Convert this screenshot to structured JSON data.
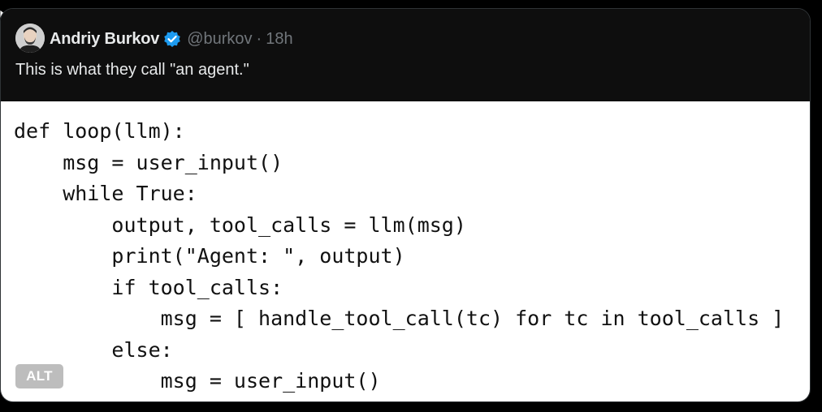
{
  "tweet": {
    "display_name": "Andriy Burkov",
    "handle": "@burkov",
    "separator": "·",
    "time": "18h",
    "text": "This is what they call \"an agent.\"",
    "verified_color": "#1d9bf0",
    "avatar_icon": "avatar-photo"
  },
  "image": {
    "alt_label": "ALT",
    "code_lines": [
      "def loop(llm):",
      "    msg = user_input()",
      "    while True:",
      "        output, tool_calls = llm(msg)",
      "        print(\"Agent: \", output)",
      "        if tool_calls:",
      "            msg = [ handle_tool_call(tc) for tc in tool_calls ]",
      "        else:",
      "            msg = user_input()"
    ]
  }
}
